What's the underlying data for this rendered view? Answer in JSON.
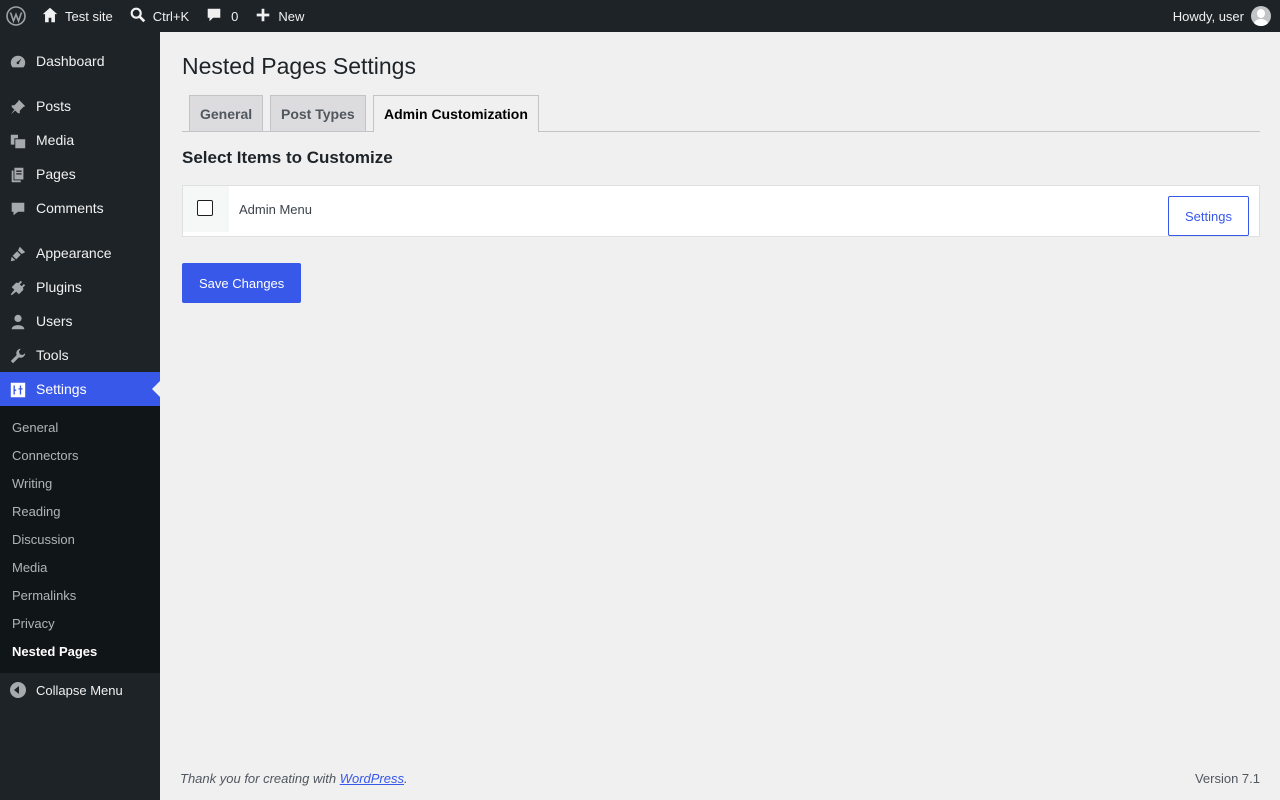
{
  "adminbar": {
    "site_name": "Test site",
    "search_shortcut": "Ctrl+K",
    "comments_count": "0",
    "new_label": "New",
    "greeting": "Howdy, user"
  },
  "sidebar": {
    "items": [
      {
        "label": "Dashboard",
        "icon": "dashboard-icon"
      },
      {
        "label": "Posts",
        "icon": "pin-icon"
      },
      {
        "label": "Media",
        "icon": "media-icon"
      },
      {
        "label": "Pages",
        "icon": "pages-icon"
      },
      {
        "label": "Comments",
        "icon": "comment-icon"
      },
      {
        "label": "Appearance",
        "icon": "brush-icon"
      },
      {
        "label": "Plugins",
        "icon": "plugin-icon"
      },
      {
        "label": "Users",
        "icon": "user-icon"
      },
      {
        "label": "Tools",
        "icon": "wrench-icon"
      },
      {
        "label": "Settings",
        "icon": "settings-icon"
      }
    ],
    "settings_submenu": [
      "General",
      "Connectors",
      "Writing",
      "Reading",
      "Discussion",
      "Media",
      "Permalinks",
      "Privacy",
      "Nested Pages"
    ],
    "collapse_label": "Collapse Menu"
  },
  "main": {
    "title": "Nested Pages Settings",
    "tabs": [
      "General",
      "Post Types",
      "Admin Customization"
    ],
    "active_tab": "Admin Customization",
    "section_title": "Select Items to Customize",
    "row": {
      "label": "Admin Menu",
      "checked": false,
      "settings_label": "Settings"
    },
    "save_label": "Save Changes"
  },
  "footer": {
    "thanks_prefix": "Thank you for creating with ",
    "link_text": "WordPress",
    "thanks_suffix": ".",
    "version": "Version 7.1"
  },
  "colors": {
    "accent": "#3858e9",
    "bar_bg": "#1d2327",
    "page_bg": "#f0f0f1"
  }
}
